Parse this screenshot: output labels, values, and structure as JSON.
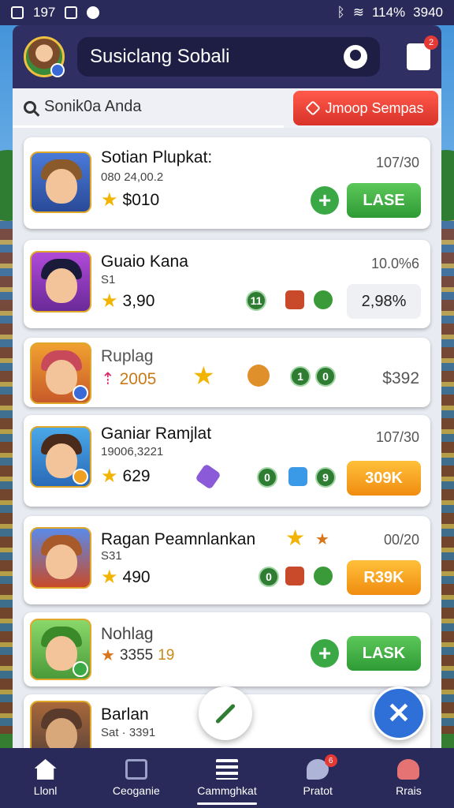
{
  "status_bar": {
    "left_text": "197",
    "battery": "114%",
    "time": "3940"
  },
  "header": {
    "title": "Susiclang Sobali",
    "notification_count": "2"
  },
  "search": {
    "placeholder": "Sonik0a Anda",
    "action_button": "Jmoop Sempas"
  },
  "rows": [
    {
      "name": "Sotian Plupkat:",
      "sub": "080 24,00.2",
      "score": "$010",
      "right": "107/30",
      "button": "LASE",
      "button_color": "green",
      "has_plus": true
    },
    {
      "name": "Guaio Kana",
      "sub": "S1",
      "score": "3,90",
      "right": "10.0%6",
      "button": "2,98%",
      "button_color": "light",
      "coins": [
        "11"
      ],
      "has_plus": false
    },
    {
      "name": "Ruplag",
      "sub": "",
      "score": "2005",
      "right": "$392",
      "button": "",
      "button_color": "none",
      "coins": [
        "1",
        "0"
      ],
      "has_plus": false
    },
    {
      "name": "Ganiar Ramjlat",
      "sub": "19006,3221",
      "score": "629",
      "right": "107/30",
      "button": "309K",
      "button_color": "orange",
      "coins": [
        "0",
        "9"
      ],
      "has_plus": false
    },
    {
      "name": "Ragan Peamnlankan",
      "sub": "S31",
      "score": "490",
      "right": "00/20",
      "button": "R39K",
      "button_color": "orange",
      "coins": [
        "0"
      ],
      "has_plus": false
    },
    {
      "name": "Nohlag",
      "sub": "",
      "score": "3355",
      "score_extra": "19",
      "right": "",
      "button": "LASK",
      "button_color": "green",
      "has_plus": true
    },
    {
      "name": "Barlan",
      "sub": "Sat · 3391",
      "score": "",
      "right": "",
      "button": "",
      "button_color": "none",
      "has_plus": false
    }
  ],
  "bottom_nav": [
    {
      "label": "Llonl",
      "icon": "home-icon"
    },
    {
      "label": "Ceoganie",
      "icon": "bag-icon"
    },
    {
      "label": "Cammghkat",
      "icon": "list-icon",
      "active": true
    },
    {
      "label": "Pratot",
      "icon": "chat-icon",
      "badge": "6"
    },
    {
      "label": "Rrais",
      "icon": "person-icon"
    }
  ],
  "colors": {
    "accent_green": "#3aa844",
    "accent_orange": "#f5a020",
    "accent_red": "#e5392e",
    "nav_bg": "#2a2a5a",
    "fab_blue": "#2f6fd8"
  }
}
